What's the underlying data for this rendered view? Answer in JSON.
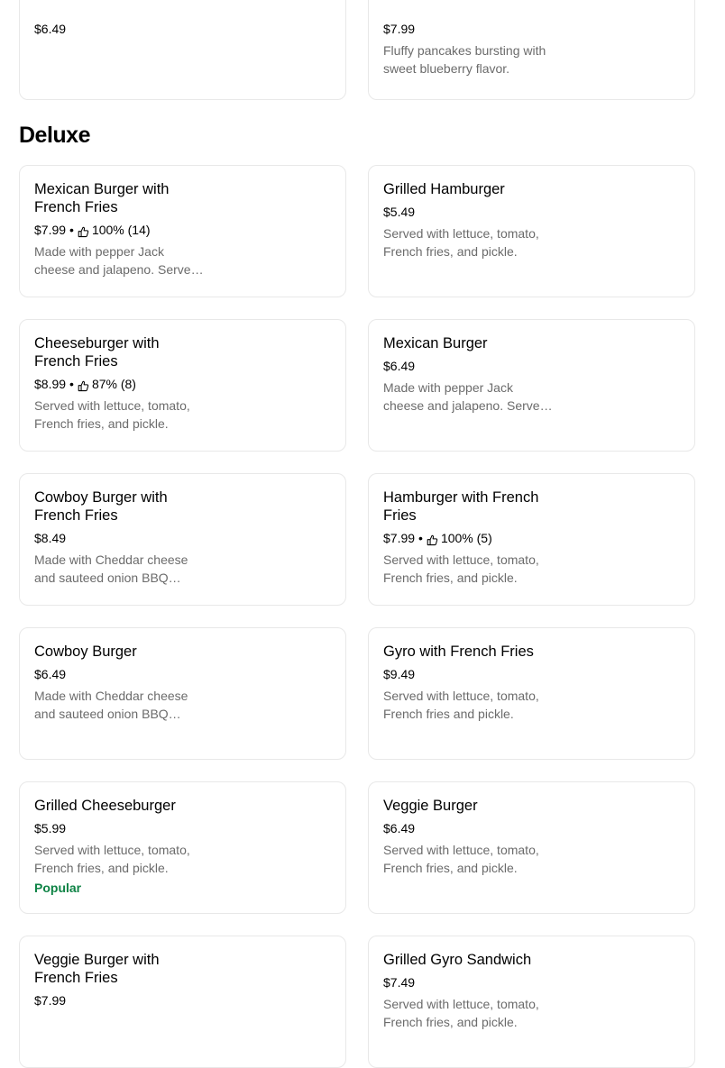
{
  "top_cards": [
    {
      "price": "$6.49",
      "description": ""
    },
    {
      "price": "$7.99",
      "description": "Fluffy pancakes bursting with sweet blueberry flavor."
    }
  ],
  "section": {
    "title": "Deluxe"
  },
  "items": [
    {
      "name": "Mexican Burger with French Fries",
      "price": "$7.99",
      "rating": "100% (14)",
      "description": "Made with pepper Jack cheese and jalapeno. Served with lettuce, tomato, French fries, and pickle.",
      "badge": ""
    },
    {
      "name": "Grilled Hamburger",
      "price": "$5.49",
      "rating": "",
      "description": "Served with lettuce, tomato, French fries, and pickle.",
      "badge": ""
    },
    {
      "name": "Cheeseburger with French Fries",
      "price": "$8.99",
      "rating": "87% (8)",
      "description": "Served with lettuce, tomato, French fries, and pickle.",
      "badge": ""
    },
    {
      "name": "Mexican Burger",
      "price": "$6.49",
      "rating": "",
      "description": "Made with pepper Jack cheese and jalapeno. Served with lettuce, tomato, French fries, and pickle.",
      "badge": ""
    },
    {
      "name": "Cowboy Burger with French Fries",
      "price": "$8.49",
      "rating": "",
      "description": "Made with Cheddar cheese and sauteed onion BBQ sauce. Served with lettuce, tomato, French fries, and pickle.",
      "badge": ""
    },
    {
      "name": "Hamburger with French Fries",
      "price": "$7.99",
      "rating": "100% (5)",
      "description": "Served with lettuce, tomato, French fries, and pickle.",
      "badge": ""
    },
    {
      "name": "Cowboy Burger",
      "price": "$6.49",
      "rating": "",
      "description": "Made with Cheddar cheese and sauteed onion BBQ sauce. Served with lettuce, tomato, French fries, and pickle.",
      "badge": ""
    },
    {
      "name": "Gyro with French Fries",
      "price": "$9.49",
      "rating": "",
      "description": "Served with lettuce, tomato, French fries and pickle.",
      "badge": ""
    },
    {
      "name": "Grilled Cheeseburger",
      "price": "$5.99",
      "rating": "",
      "description": "Served with lettuce, tomato, French fries, and pickle.",
      "badge": "Popular"
    },
    {
      "name": "Veggie Burger",
      "price": "$6.49",
      "rating": "",
      "description": "Served with lettuce, tomato, French fries, and pickle.",
      "badge": ""
    },
    {
      "name": "Veggie Burger with French Fries",
      "price": "$7.99",
      "rating": "",
      "description": "",
      "badge": ""
    },
    {
      "name": "Grilled Gyro Sandwich",
      "price": "$7.49",
      "rating": "",
      "description": "Served with lettuce, tomato, French fries, and pickle.",
      "badge": ""
    }
  ],
  "colors": {
    "accent_green": "#0e8345",
    "muted_text": "#6b6b6b",
    "card_border": "#e8e8e8"
  },
  "icons": {
    "rating": "thumbs-up-icon"
  }
}
